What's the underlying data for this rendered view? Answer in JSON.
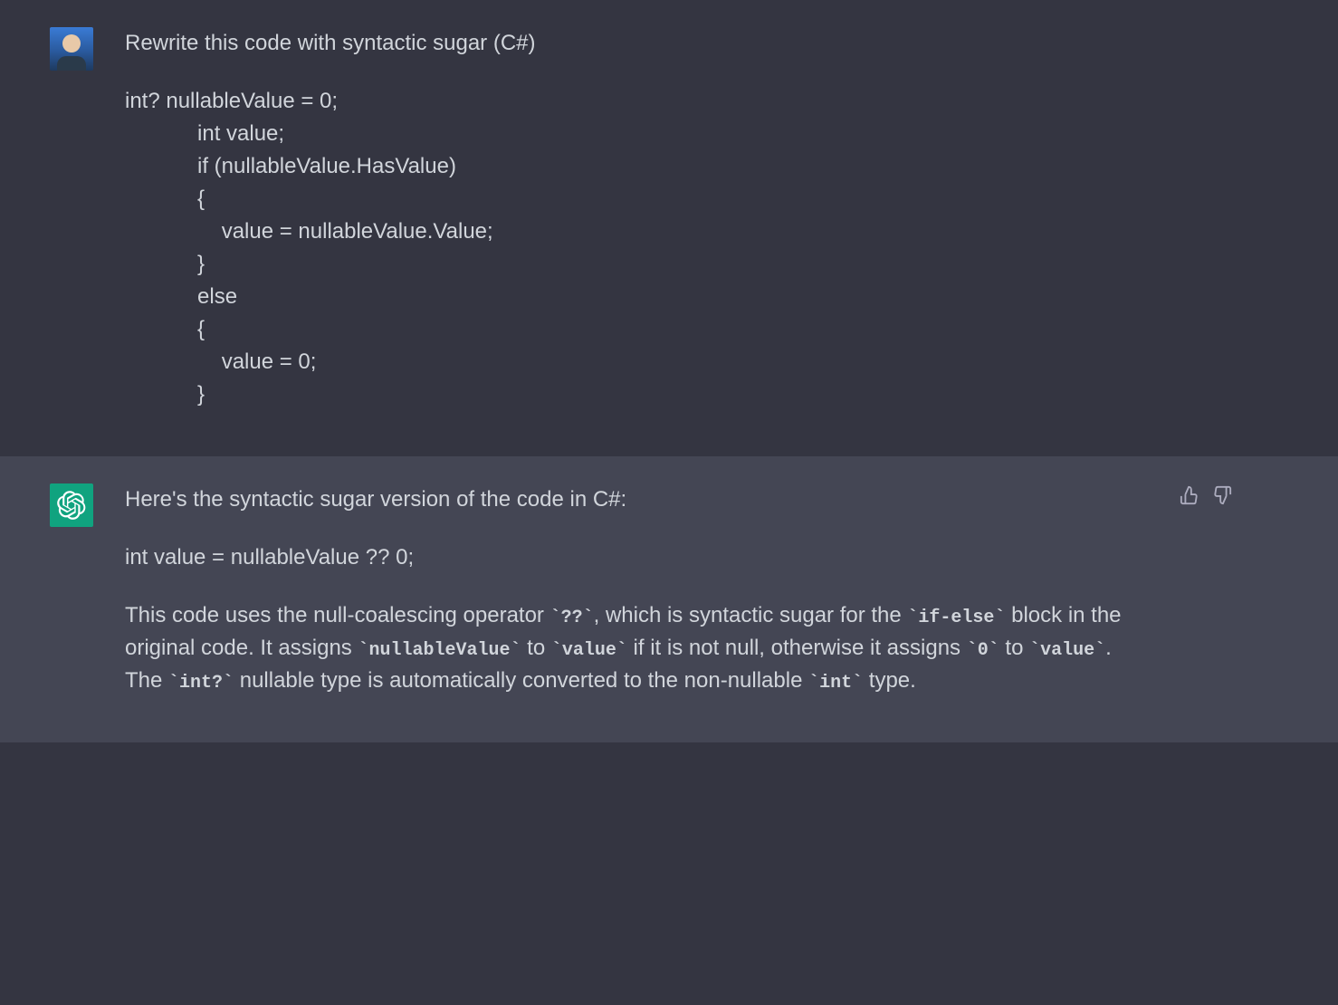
{
  "user_message": {
    "prompt": "Rewrite this code with syntactic sugar (C#)",
    "code": "int? nullableValue = 0;\n            int value;\n            if (nullableValue.HasValue)\n            {\n                value = nullableValue.Value;\n            }\n            else\n            {\n                value = 0;\n            }"
  },
  "assistant_message": {
    "intro": "Here's the syntactic sugar version of the code in C#:",
    "code": "int value = nullableValue ?? 0;",
    "explanation": {
      "seg1": "This code uses the null-coalescing operator ",
      "c1": "`??`",
      "seg2": ", which is syntactic sugar for the ",
      "c2": "`if-else`",
      "seg3": " block in the original code. It assigns ",
      "c3": "`nullableValue`",
      "seg4": " to ",
      "c4": "`value`",
      "seg5": " if it is not null, otherwise it assigns ",
      "c5": "`0`",
      "seg6": " to ",
      "c6": "`value`",
      "seg7": ". The ",
      "c7": "`int?`",
      "seg8": " nullable type is automatically converted to the non-nullable ",
      "c8": "`int`",
      "seg9": " type."
    }
  }
}
